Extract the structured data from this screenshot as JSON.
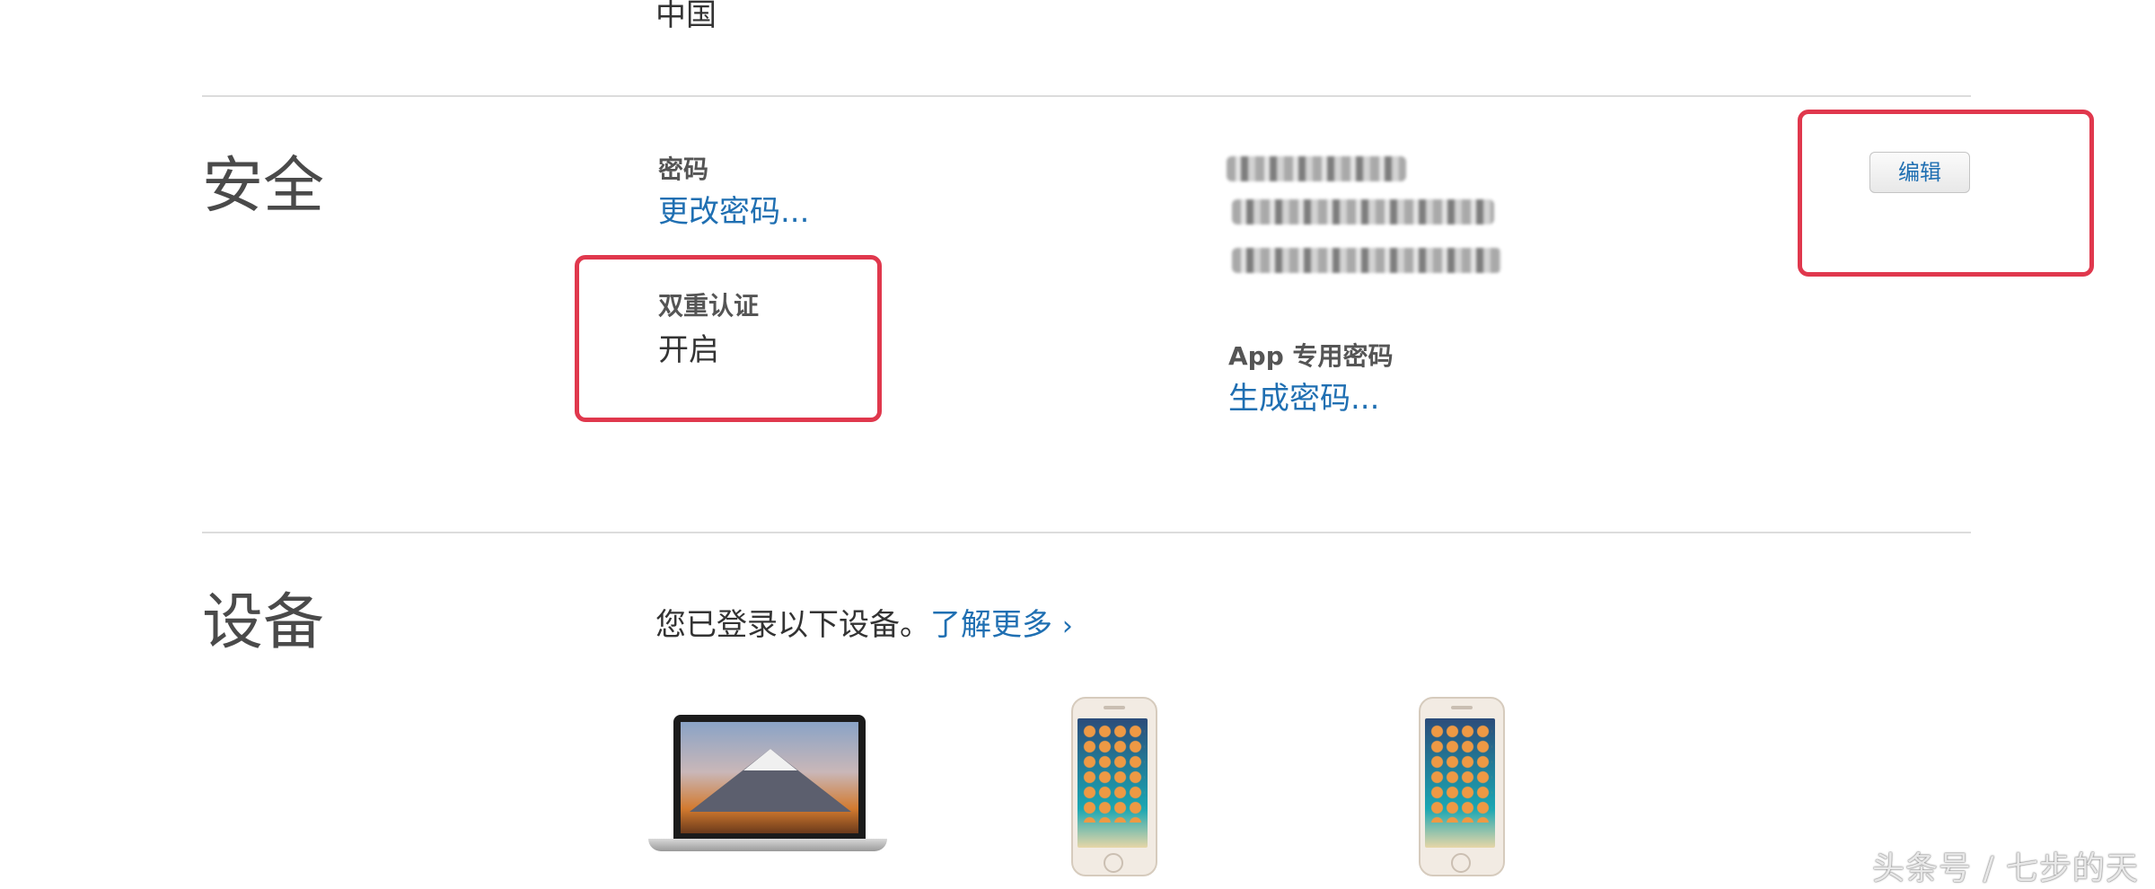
{
  "contact": {
    "country": "中国"
  },
  "security": {
    "title": "安全",
    "password_label": "密码",
    "change_password_link": "更改密码...",
    "two_factor_label": "双重认证",
    "two_factor_value": "开启",
    "app_passwords_label": "App 专用密码",
    "generate_password_link": "生成密码...",
    "edit_button": "编辑"
  },
  "devices": {
    "title": "设备",
    "intro": "您已登录以下设备。",
    "learn_more_link": "了解更多",
    "learn_more_chevron": "›",
    "items": [
      {
        "icon": "macbook-icon"
      },
      {
        "icon": "iphone-icon"
      },
      {
        "icon": "iphone-icon"
      }
    ]
  },
  "watermark": "头条号 / 七步的天",
  "colors": {
    "link": "#1f6fb2",
    "highlight": "#e0384d",
    "divider": "#dcdcdc"
  }
}
